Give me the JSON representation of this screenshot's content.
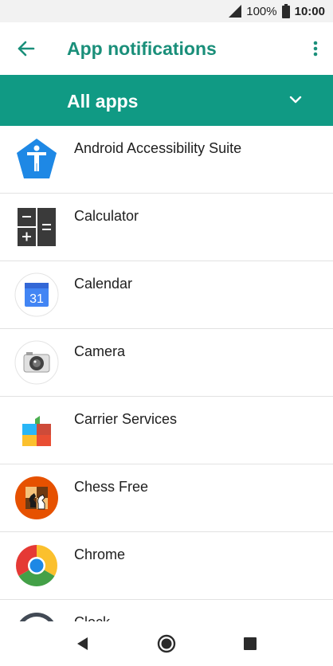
{
  "status_bar": {
    "battery": "100%",
    "time": "10:00"
  },
  "header": {
    "title": "App notifications",
    "back_icon": "arrow-back-icon",
    "menu_icon": "more-vert-icon"
  },
  "filter": {
    "selected": "All apps",
    "icon": "chevron-down-icon"
  },
  "apps": [
    {
      "name": "Android Accessibility Suite"
    },
    {
      "name": "Calculator"
    },
    {
      "name": "Calendar",
      "icon_text": "31"
    },
    {
      "name": "Camera"
    },
    {
      "name": "Carrier Services"
    },
    {
      "name": "Chess Free"
    },
    {
      "name": "Chrome"
    },
    {
      "name": "Clock"
    }
  ],
  "navigation": {
    "back": "back-icon",
    "home": "home-icon",
    "recents": "recents-icon"
  },
  "colors": {
    "accent": "#1a8f7a",
    "filter_bar": "#109a84"
  }
}
